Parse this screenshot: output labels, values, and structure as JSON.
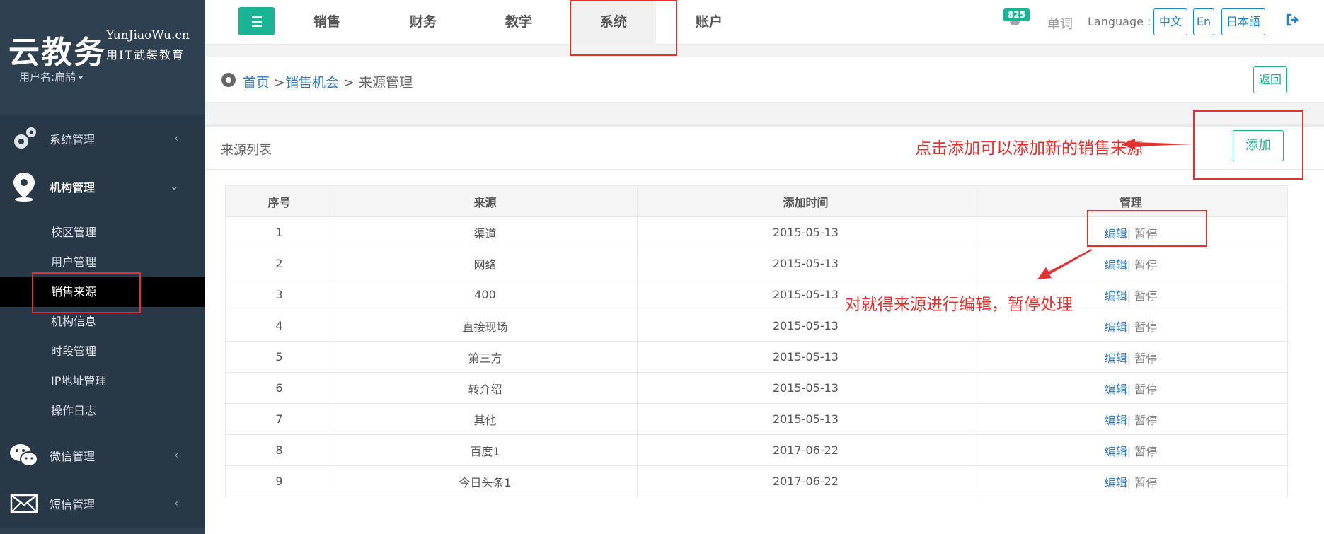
{
  "brand": {
    "name": "云教务",
    "domain": "YunJiaoWu.cn",
    "slogan": "用IT武装教育",
    "user_label": "用户名:扁鹊"
  },
  "sidebar": {
    "groups": [
      {
        "label": "系统管理",
        "icon": "gears-icon",
        "arrow": "‹"
      },
      {
        "label": "机构管理",
        "icon": "location-pin-icon",
        "arrow": "⌄"
      },
      {
        "label": "微信管理",
        "icon": "wechat-icon",
        "arrow": "‹"
      },
      {
        "label": "短信管理",
        "icon": "envelope-icon",
        "arrow": "‹"
      }
    ],
    "sub_items": [
      "校区管理",
      "用户管理",
      "销售来源",
      "机构信息",
      "时段管理",
      "IP地址管理",
      "操作日志"
    ],
    "active_sub": "销售来源"
  },
  "topnav": {
    "tabs": [
      "销售",
      "财务",
      "教学",
      "系统",
      "账户"
    ],
    "active_tab": "系统",
    "badge": "825",
    "word_label": "单词",
    "language_label": "Language :",
    "languages": [
      "中文",
      "En",
      "日本語"
    ]
  },
  "breadcrumb": {
    "home": "首页",
    "sep": " >",
    "level2": "销售机会",
    "current": " > 来源管理",
    "back_label": "返回"
  },
  "panel": {
    "title": "来源列表",
    "add_label": "添加",
    "annotation_add": "点击添加可以添加新的销售来源",
    "annotation_edit": "对就得来源进行编辑，暂停处理"
  },
  "table": {
    "headers": [
      "序号",
      "来源",
      "添加时间",
      "管理"
    ],
    "edit_label": "编辑",
    "sep": "| ",
    "pause_label": "暂停",
    "rows": [
      {
        "no": "1",
        "source": "渠道",
        "date": "2015-05-13"
      },
      {
        "no": "2",
        "source": "网络",
        "date": "2015-05-13"
      },
      {
        "no": "3",
        "source": "400",
        "date": "2015-05-13"
      },
      {
        "no": "4",
        "source": "直接现场",
        "date": "2015-05-13"
      },
      {
        "no": "5",
        "source": "第三方",
        "date": "2015-05-13"
      },
      {
        "no": "6",
        "source": "转介绍",
        "date": "2015-05-13"
      },
      {
        "no": "7",
        "source": "其他",
        "date": "2015-05-13"
      },
      {
        "no": "8",
        "source": "百度1",
        "date": "2017-06-22"
      },
      {
        "no": "9",
        "source": "今日头条1",
        "date": "2017-06-22"
      }
    ]
  },
  "colors": {
    "sidebar_bg": "#2f4050",
    "accent_green": "#1ab394",
    "link_blue": "#337ab7",
    "annotation_red": "#e63030"
  }
}
